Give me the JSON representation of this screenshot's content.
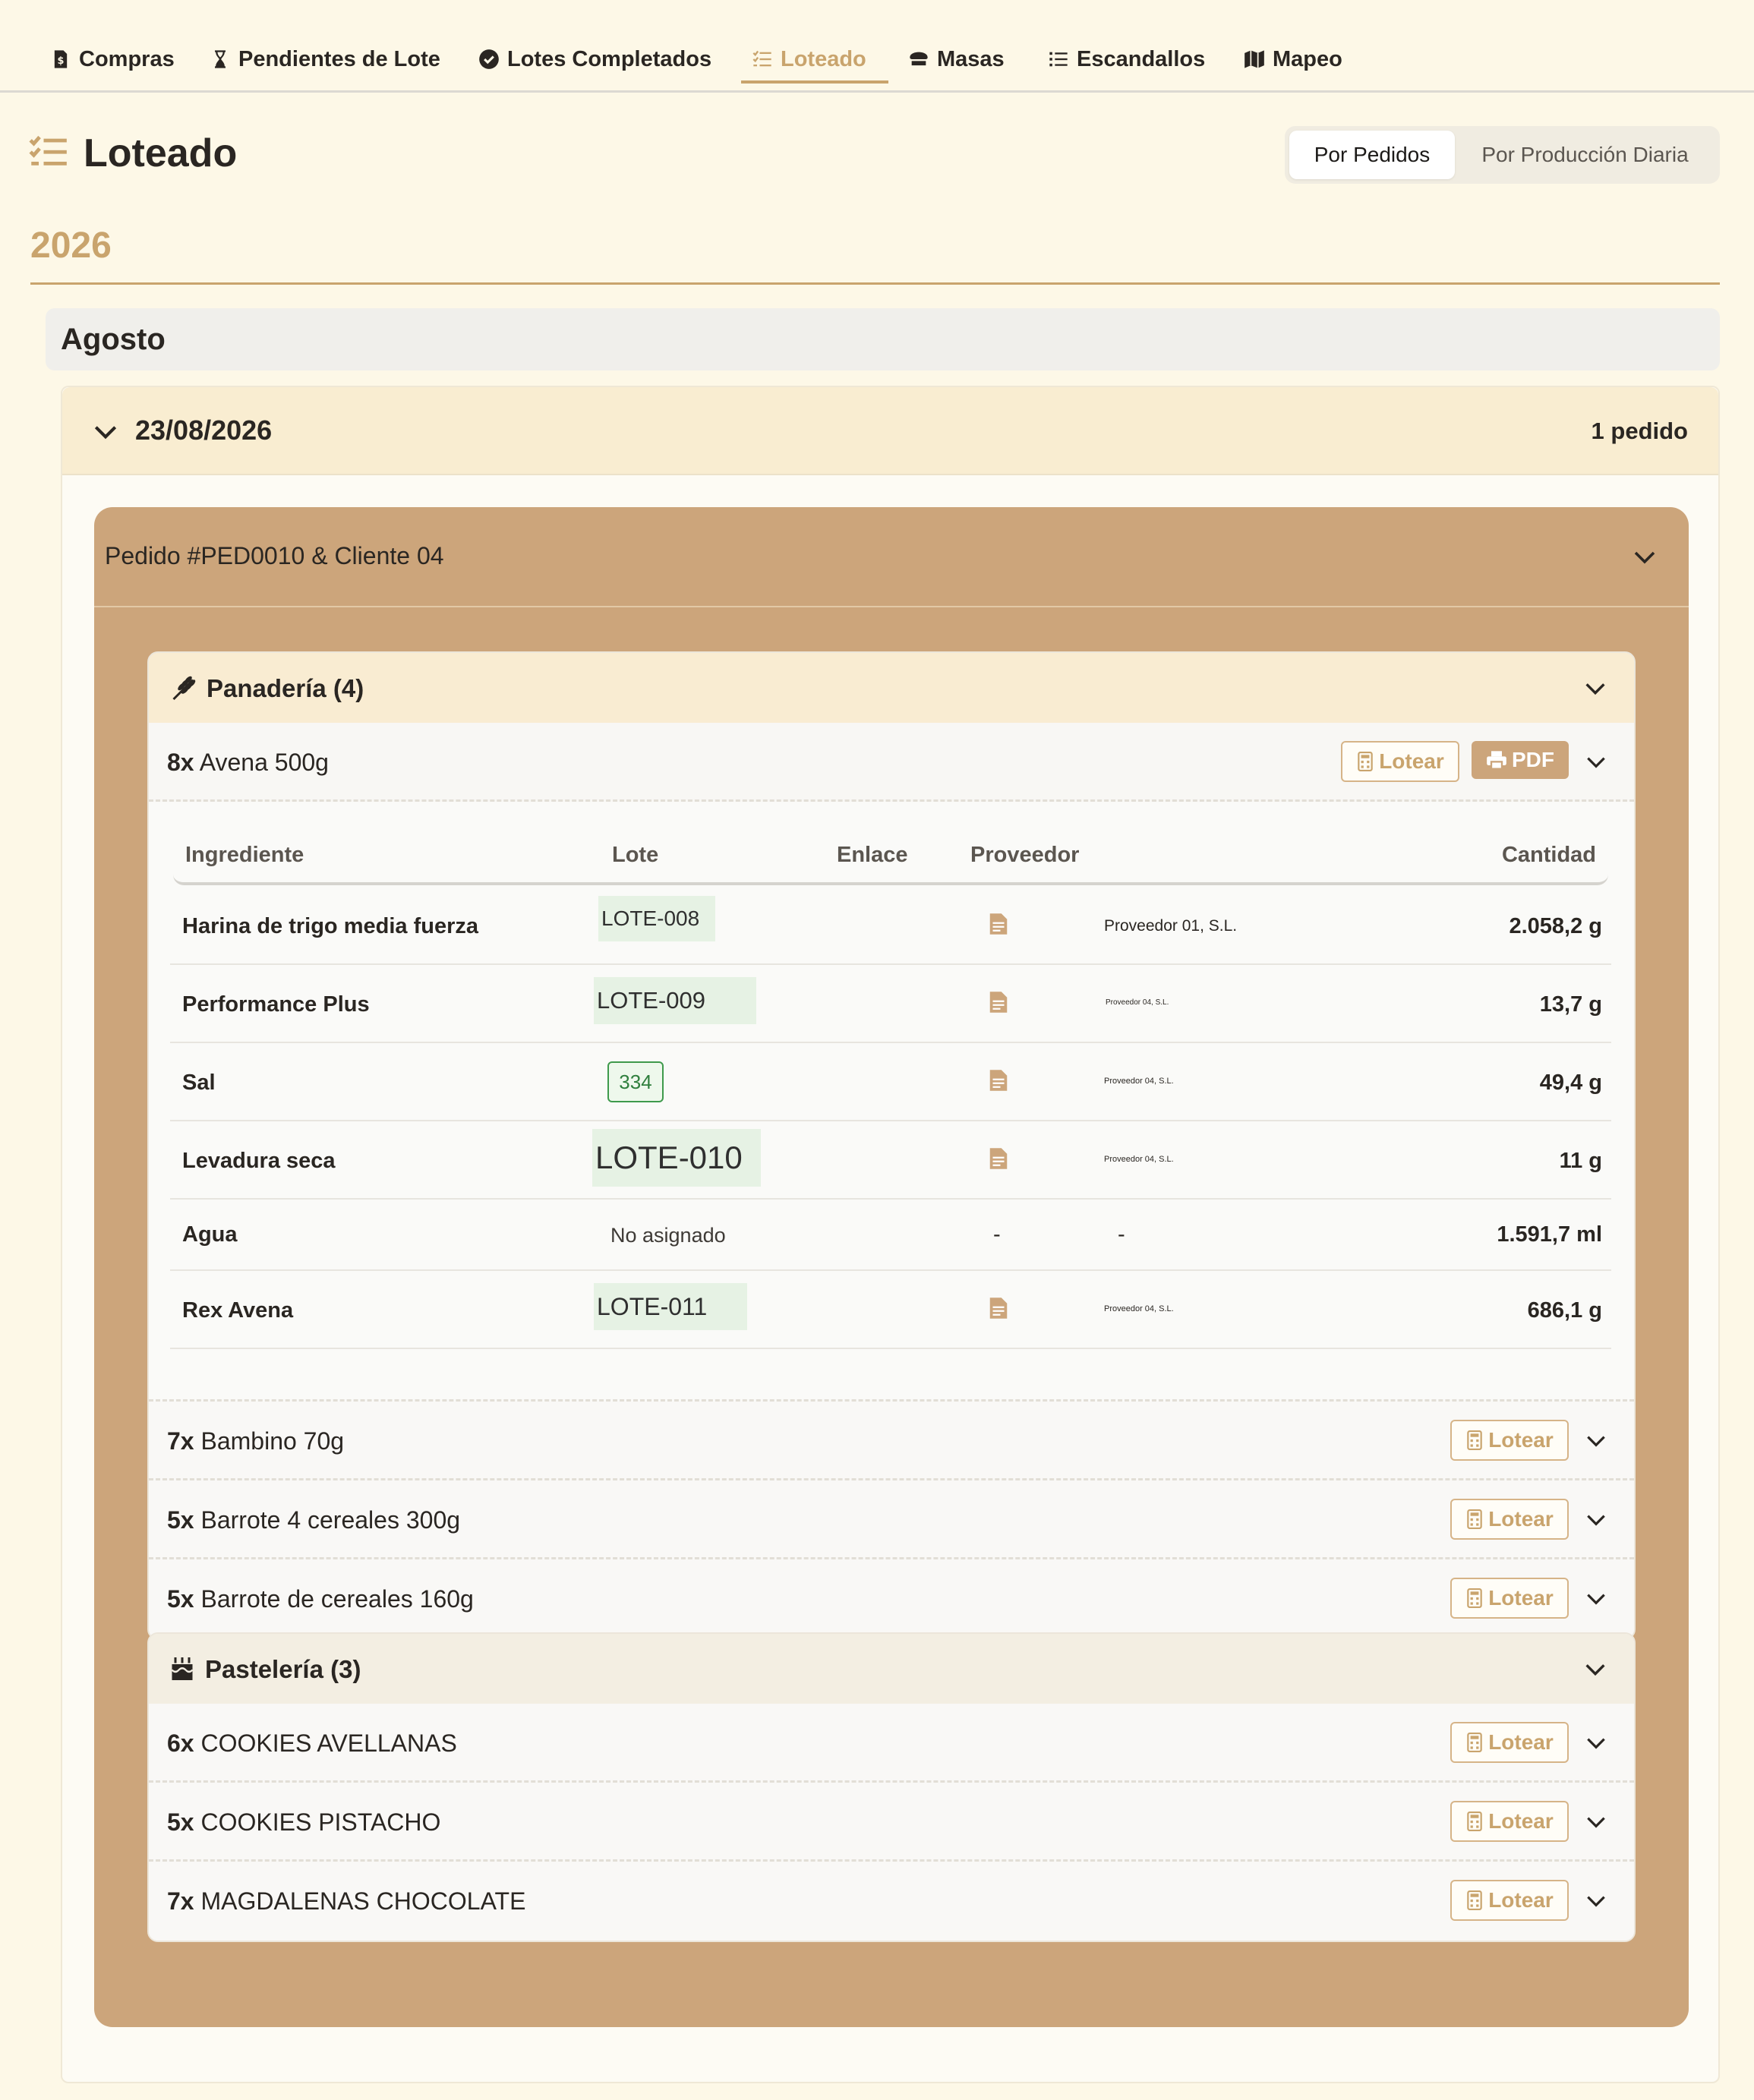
{
  "nav": {
    "tabs": [
      {
        "label": "Compras",
        "icon": "file-invoice-dollar-icon"
      },
      {
        "label": "Pendientes de Lote",
        "icon": "hourglass-icon"
      },
      {
        "label": "Lotes Completados",
        "icon": "check-circle-icon"
      },
      {
        "label": "Loteado",
        "icon": "list-check-icon",
        "active": true
      },
      {
        "label": "Masas",
        "icon": "bread-icon"
      },
      {
        "label": "Escandallos",
        "icon": "list-icon"
      },
      {
        "label": "Mapeo",
        "icon": "map-icon"
      }
    ]
  },
  "page": {
    "title": "Loteado",
    "view_toggle": {
      "options": [
        "Por Pedidos",
        "Por Producción Diaria"
      ],
      "selected": "Por Pedidos"
    },
    "year": "2026",
    "month": "Agosto"
  },
  "date_group": {
    "date": "23/08/2026",
    "order_count": "1 pedido"
  },
  "order": {
    "title": "Pedido #PED0010 & Cliente 04",
    "categories": [
      {
        "name": "Panadería (4)",
        "icon": "wheat-icon",
        "products": [
          {
            "qty": "8x",
            "name": "Avena 500g",
            "expanded": true
          },
          {
            "qty": "7x",
            "name": "Bambino 70g"
          },
          {
            "qty": "5x",
            "name": "Barrote 4 cereales 300g"
          },
          {
            "qty": "5x",
            "name": "Barrote de cereales 160g"
          }
        ]
      },
      {
        "name": "Pastelería (3)",
        "icon": "cake-icon",
        "products": [
          {
            "qty": "6x",
            "name": "COOKIES AVELLANAS"
          },
          {
            "qty": "5x",
            "name": "COOKIES PISTACHO"
          },
          {
            "qty": "7x",
            "name": "MAGDALENAS CHOCOLATE"
          }
        ]
      }
    ]
  },
  "buttons": {
    "lotear": "Lotear",
    "pdf": "PDF"
  },
  "ingredient_table": {
    "headers": [
      "Ingrediente",
      "Lote",
      "Enlace",
      "Proveedor",
      "Cantidad"
    ],
    "rows": [
      {
        "ingredient": "Harina de trigo media fuerza",
        "lote": "LOTE-008",
        "enlace": "file-icon",
        "proveedor": "Proveedor 01, S.L.",
        "cantidad": "2.058,2 g"
      },
      {
        "ingredient": "Performance Plus",
        "lote": "LOTE-009",
        "enlace": "file-icon",
        "proveedor": "Proveedor 04, S.L.",
        "cantidad": "13,7 g"
      },
      {
        "ingredient": "Sal",
        "lote": "334",
        "enlace": "file-icon",
        "proveedor": "Proveedor 04, S.L.",
        "cantidad": "49,4 g"
      },
      {
        "ingredient": "Levadura seca",
        "lote": "LOTE-010",
        "enlace": "file-icon",
        "proveedor": "Proveedor 04, S.L.",
        "cantidad": "11 g"
      },
      {
        "ingredient": "Agua",
        "lote": "No asignado",
        "enlace": "-",
        "proveedor": "-",
        "cantidad": "1.591,7 ml"
      },
      {
        "ingredient": "Rex Avena",
        "lote": "LOTE-011",
        "enlace": "file-icon",
        "proveedor": "Proveedor 04, S.L.",
        "cantidad": "686,1 g"
      }
    ]
  },
  "colors": {
    "background": "#fdf8e7",
    "accent": "#c9a46d",
    "order_card": "#cca57b",
    "lote_chip": "#e6f2e4",
    "lote_badge_border": "#3f9a4c"
  }
}
